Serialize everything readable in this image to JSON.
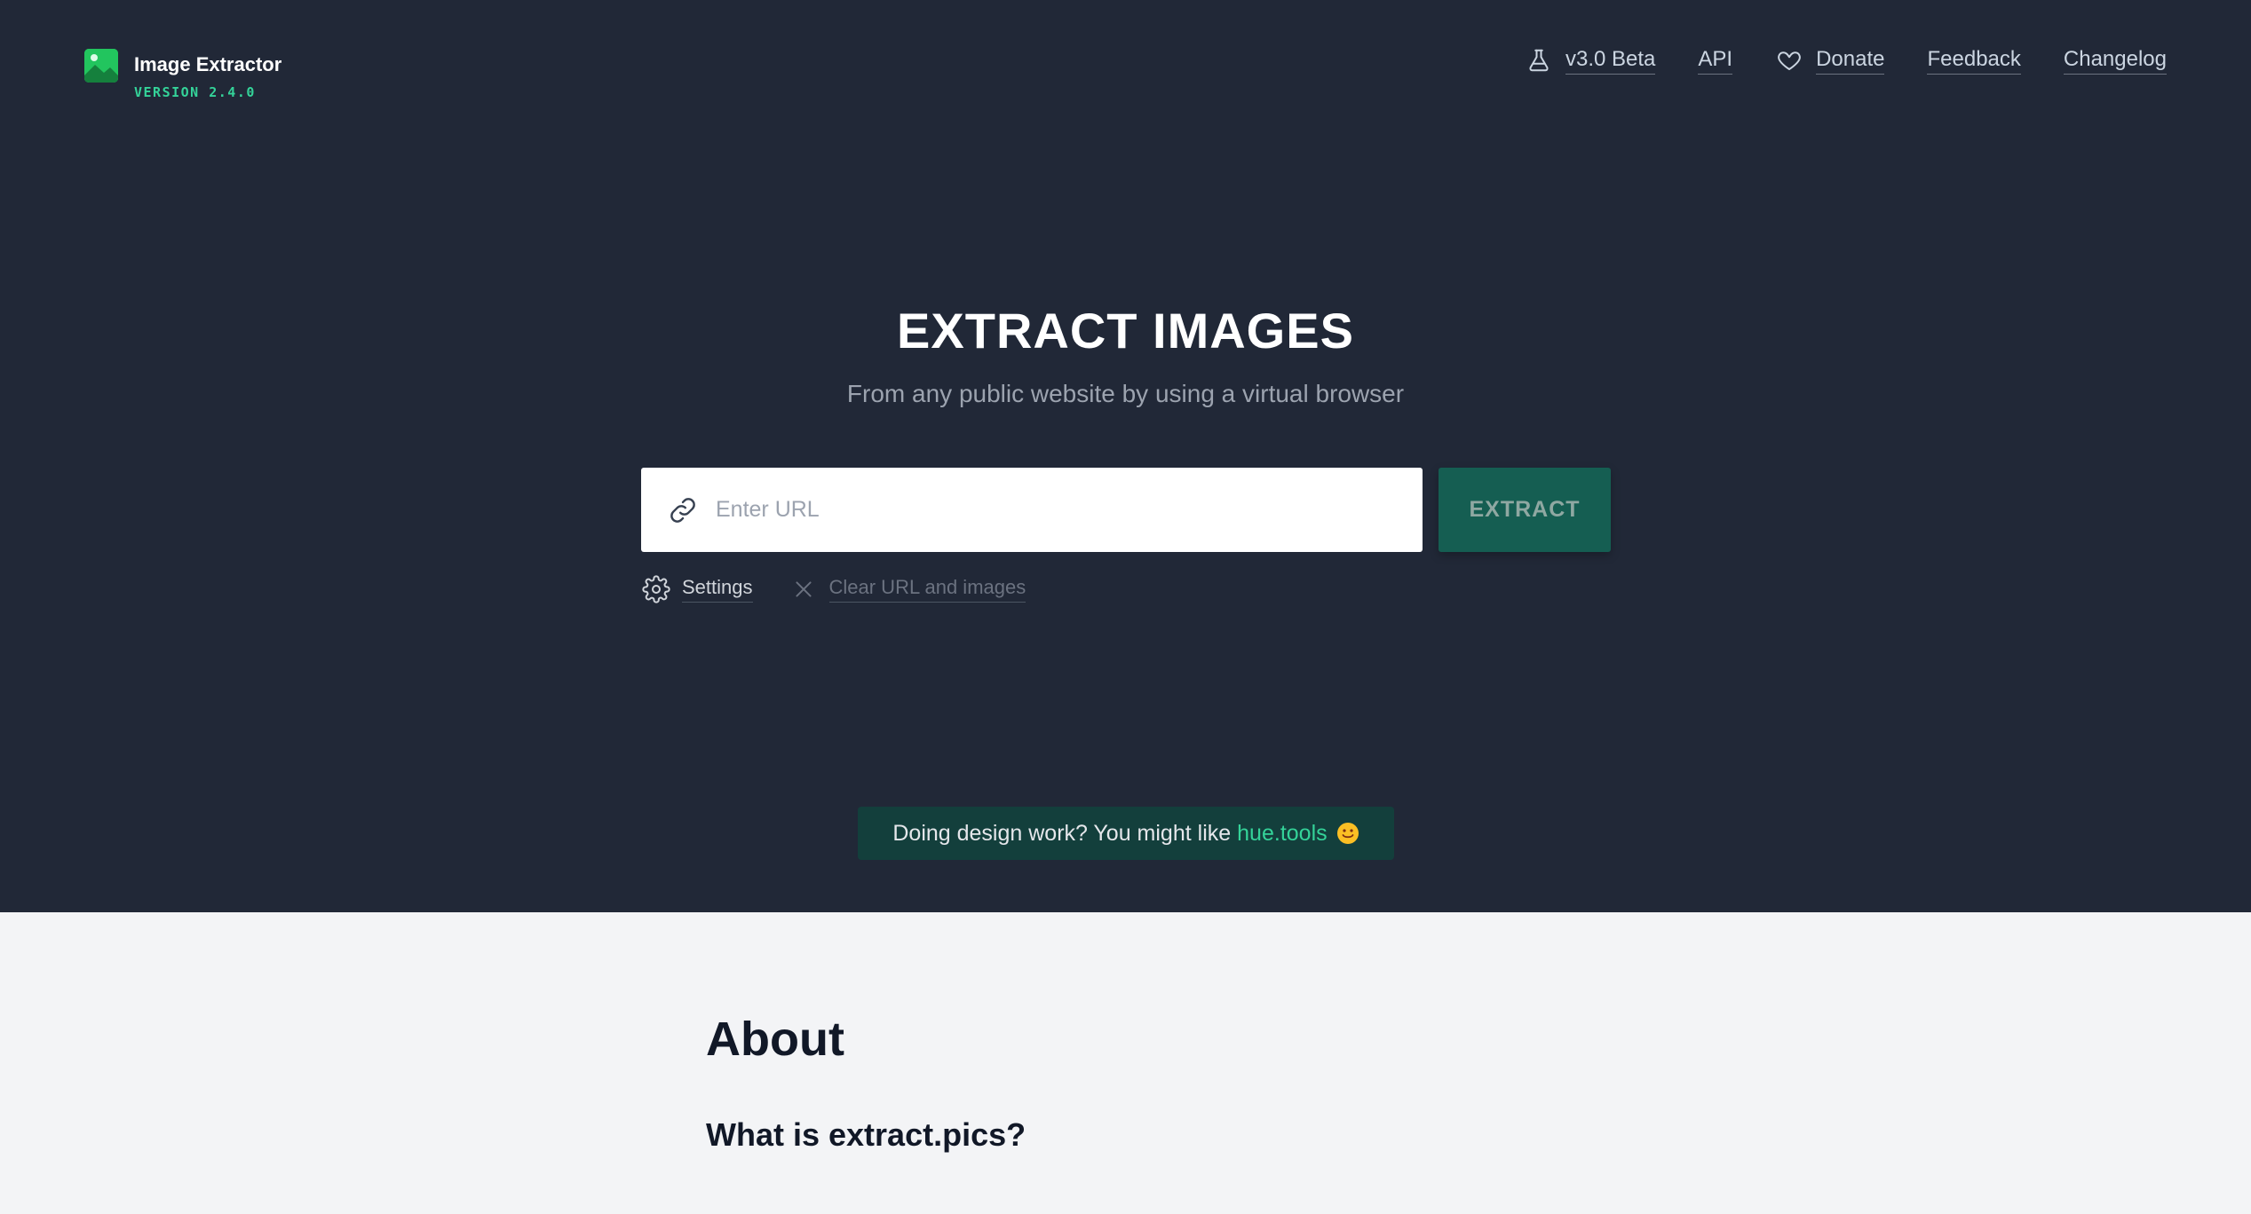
{
  "header": {
    "brand_title": "Image Extractor",
    "brand_version": "VERSION 2.4.0",
    "nav": {
      "beta": "v3.0 Beta",
      "api": "API",
      "donate": "Donate",
      "feedback": "Feedback",
      "changelog": "Changelog"
    },
    "icons": [
      "image-logo-icon",
      "flask-icon",
      "heart-icon"
    ]
  },
  "hero": {
    "headline": "EXTRACT IMAGES",
    "subhead": "From any public website by using a virtual browser",
    "url_placeholder": "Enter URL",
    "url_value": "",
    "extract_label": "EXTRACT",
    "settings_label": "Settings",
    "clear_label": "Clear URL and images"
  },
  "promo": {
    "text": "Doing design work? You might like",
    "link": "hue.tools"
  },
  "about": {
    "title": "About",
    "question": "What is extract.pics?"
  },
  "colors": {
    "hero_bg": "#212837",
    "accent_green": "#34d399",
    "button_bg": "#155e52",
    "page_bg": "#f3f4f6"
  }
}
